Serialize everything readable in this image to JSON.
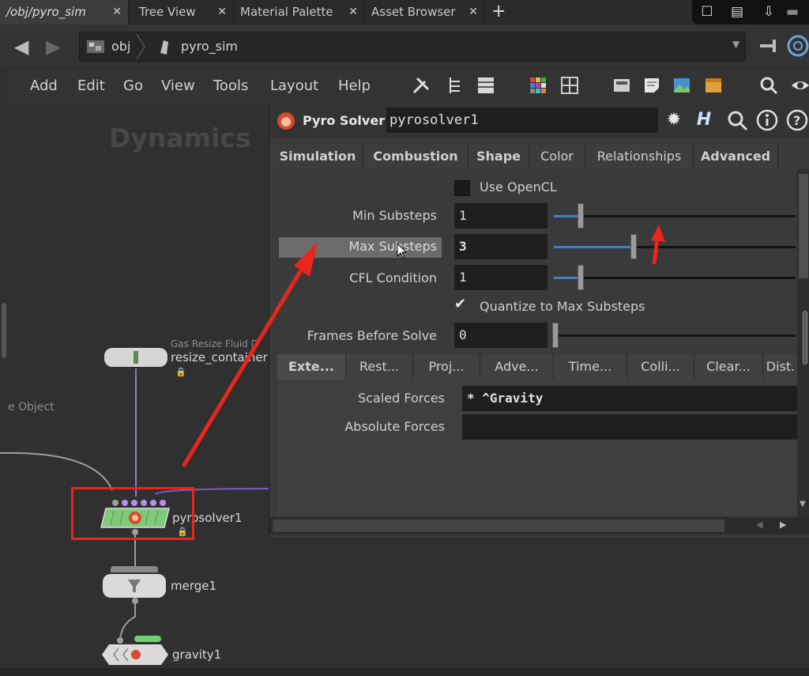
{
  "tabs": [
    {
      "label": "/obj/pyro_sim",
      "active": true
    },
    {
      "label": "Tree View",
      "active": false
    },
    {
      "label": "Material Palette",
      "active": false
    },
    {
      "label": "Asset Browser",
      "active": false
    }
  ],
  "path": {
    "segments": [
      "obj",
      "pyro_sim"
    ]
  },
  "menu": [
    "Add",
    "Edit",
    "Go",
    "View",
    "Tools",
    "Layout",
    "Help"
  ],
  "network": {
    "context_label": "Dynamics",
    "partial_label": "e Object",
    "nodes": [
      {
        "name": "resize_container",
        "type_label": "Gas Resize Fluid D"
      },
      {
        "name": "pyrosolver1"
      },
      {
        "name": "merge1"
      },
      {
        "name": "gravity1"
      }
    ]
  },
  "panel": {
    "node_type": "Pyro Solver",
    "node_name": "pyrosolver1",
    "main_tabs": [
      "Simulation",
      "Combustion",
      "Shape",
      "Color",
      "Relationships",
      "Advanced"
    ],
    "params": {
      "use_opencl": {
        "label": "Use OpenCL",
        "checked": false
      },
      "min_substeps": {
        "label": "Min Substeps",
        "value": "1",
        "slider": 0.1
      },
      "max_substeps": {
        "label": "Max Substeps",
        "value": "3",
        "slider": 0.33
      },
      "cfl_condition": {
        "label": "CFL Condition",
        "value": "1",
        "slider": 0.1
      },
      "quantize": {
        "label": "Quantize to Max Substeps",
        "checked": true
      },
      "frames_before_solve": {
        "label": "Frames Before Solve",
        "value": "0",
        "slider": 0.0
      }
    },
    "sub_tabs": [
      "Exte...",
      "Rest...",
      "Proj...",
      "Adve...",
      "Time...",
      "Colli...",
      "Clear...",
      "Dist."
    ],
    "forces": {
      "scaled_label": "Scaled Forces",
      "scaled_value": "* ^Gravity",
      "absolute_label": "Absolute Forces",
      "absolute_value": ""
    }
  },
  "colors": {
    "annotation": "#e8261b",
    "slider_fill": "#3f7fc8",
    "node_green": "#7fc97a",
    "wire_purple": "#9a6fd6"
  }
}
